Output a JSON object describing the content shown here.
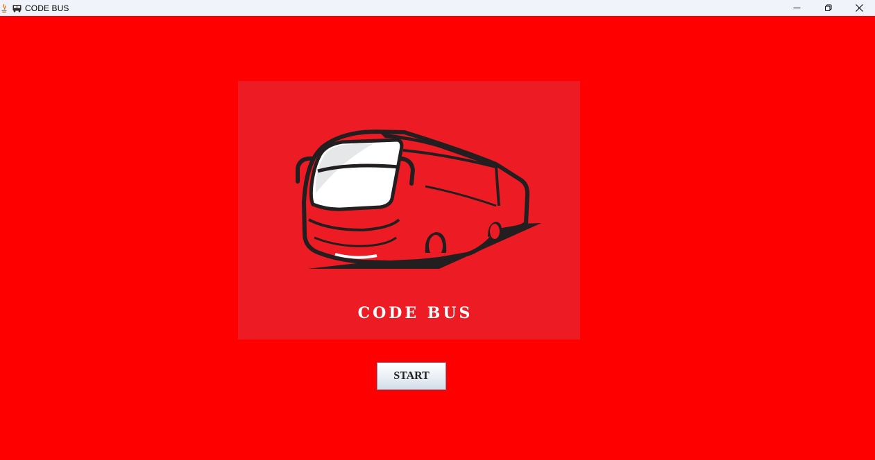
{
  "window": {
    "title": "CODE BUS",
    "app_icon": "java-icon",
    "title_icon": "bus-icon",
    "controls": {
      "minimize_icon": "minimize-icon",
      "maximize_icon": "restore-icon",
      "close_icon": "close-icon"
    }
  },
  "logo": {
    "caption": "CODE BUS",
    "image": "bus-illustration",
    "panel_color": "#ed1c24"
  },
  "actions": {
    "start_label": "START"
  },
  "colors": {
    "background": "#ff0000",
    "titlebar": "#f0f3f9"
  }
}
